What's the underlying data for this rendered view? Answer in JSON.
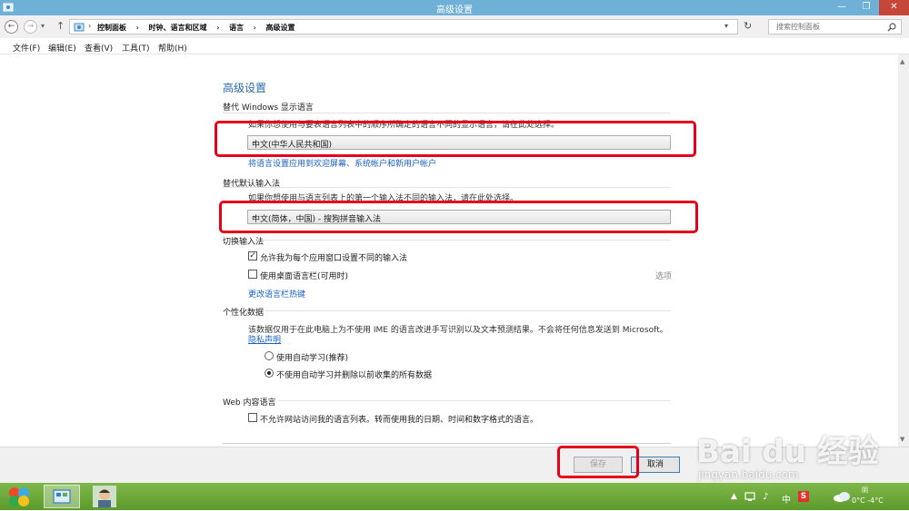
{
  "window": {
    "title": "高级设置",
    "minimize_glyph": "—",
    "restore_glyph": "❐",
    "close_glyph": "✕"
  },
  "address": {
    "crumbs": [
      "控制面板",
      "时钟、语言和区域",
      "语言",
      "高级设置"
    ],
    "search_placeholder": "搜索控制面板"
  },
  "menu": [
    "文件(F)",
    "编辑(E)",
    "查看(V)",
    "工具(T)",
    "帮助(H)"
  ],
  "page": {
    "heading": "高级设置",
    "display_lang": {
      "title": "替代 Windows 显示语言",
      "desc": "如果你想使用与要表语言列表中的顺序所确定的语言不同的显示语言，请在此处选择。",
      "value": "中文(中华人民共和国)",
      "link": "将语言设置应用到欢迎屏幕、系统帐户和新用户帐户"
    },
    "input_method": {
      "title": "替代默认输入法",
      "desc": "如果你想使用与语言列表上的第一个输入法不同的输入法，请在此处选择。",
      "value": "中文(简体，中国) - 搜狗拼音输入法"
    },
    "switch": {
      "title": "切换输入法",
      "per_app": {
        "label": "允许我为每个应用窗口设置不同的输入法",
        "checked": true
      },
      "langbar": {
        "label": "使用桌面语言栏(可用时)",
        "checked": false
      },
      "options_link": "选项",
      "hotkey_link": "更改语言栏热键"
    },
    "personal": {
      "title": "个性化数据",
      "desc": "该数据仅用于在此电脑上为不使用 IME 的语言改进手写识别以及文本预测结果。不会将任何信息发送到 Microsoft。",
      "privacy_link": "隐私声明",
      "opt_auto": "使用自动学习(推荐)",
      "opt_no_auto": "不使用自动学习并删除以前收集的所有数据",
      "selected": "opt_no_auto"
    },
    "web": {
      "title": "Web 内容语言",
      "label": "不允许网站访问我的语言列表。转而使用我的日期、时间和数字格式的语言。",
      "checked": false
    }
  },
  "buttons": {
    "save": "保存",
    "cancel": "取消"
  },
  "taskbar": {
    "ime_indicator": "中",
    "weather": "阴",
    "temp": "0°C -4°C"
  },
  "watermark": {
    "logo": "Bai du 经验",
    "url": "jingyan.baidu.com"
  },
  "colors": {
    "accent_link": "#1a62c4",
    "heading": "#2a6db0",
    "highlight_box": "#e4001b",
    "titlebar": "#6fb0d6"
  }
}
